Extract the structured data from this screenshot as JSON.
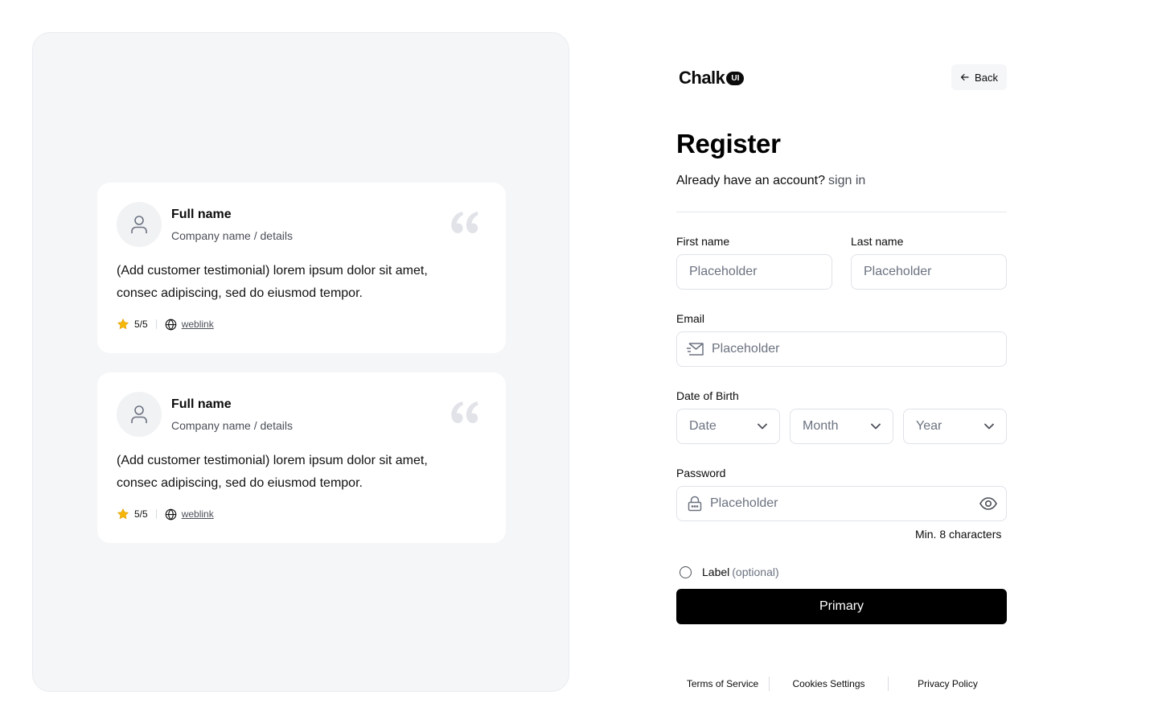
{
  "testimonials": [
    {
      "name": "Full name",
      "company": "Company name / details",
      "text": "(Add customer testimonial) lorem ipsum dolor sit amet, consec adipiscing, sed do eiusmod tempor.",
      "rating": "5/5",
      "link": "weblink",
      "icons": {
        "avatar": "user-icon",
        "quote": "quote-icon",
        "star": "star-icon",
        "globe": "globe-icon"
      }
    },
    {
      "name": "Full name",
      "company": "Company name / details",
      "text": "(Add customer testimonial) lorem ipsum dolor sit amet, consec adipiscing, sed do eiusmod tempor.",
      "rating": "5/5",
      "link": "weblink",
      "icons": {
        "avatar": "user-icon",
        "quote": "quote-icon",
        "star": "star-icon",
        "globe": "globe-icon"
      }
    }
  ],
  "header": {
    "logo_text": "Chalk",
    "logo_badge": "UI",
    "back_label": "Back"
  },
  "form": {
    "title": "Register",
    "subtitle": "Already have an account?",
    "signin_link": "sign in",
    "first_name": {
      "label": "First name",
      "placeholder": "Placeholder"
    },
    "last_name": {
      "label": "Last name",
      "placeholder": "Placeholder"
    },
    "email": {
      "label": "Email",
      "placeholder": "Placeholder",
      "icon": "mail-icon"
    },
    "dob": {
      "label": "Date of Birth",
      "date": "Date",
      "month": "Month",
      "year": "Year"
    },
    "password": {
      "label": "Password",
      "placeholder": "Placeholder",
      "hint": "Min. 8 characters",
      "lead_icon": "lock-icon",
      "trail_icon": "eye-icon"
    },
    "radio": {
      "label": "Label",
      "optional": "(optional)",
      "checked": false
    },
    "submit_label": "Primary"
  },
  "footer": {
    "links": [
      "Terms of Service",
      "Cookies Settings",
      "Privacy Policy"
    ]
  },
  "colors": {
    "panel_bg": "#f5f6f8",
    "primary": "#000000",
    "star": "#f5b70a",
    "muted_text": "#6b7280",
    "border": "#dfe2e7"
  }
}
